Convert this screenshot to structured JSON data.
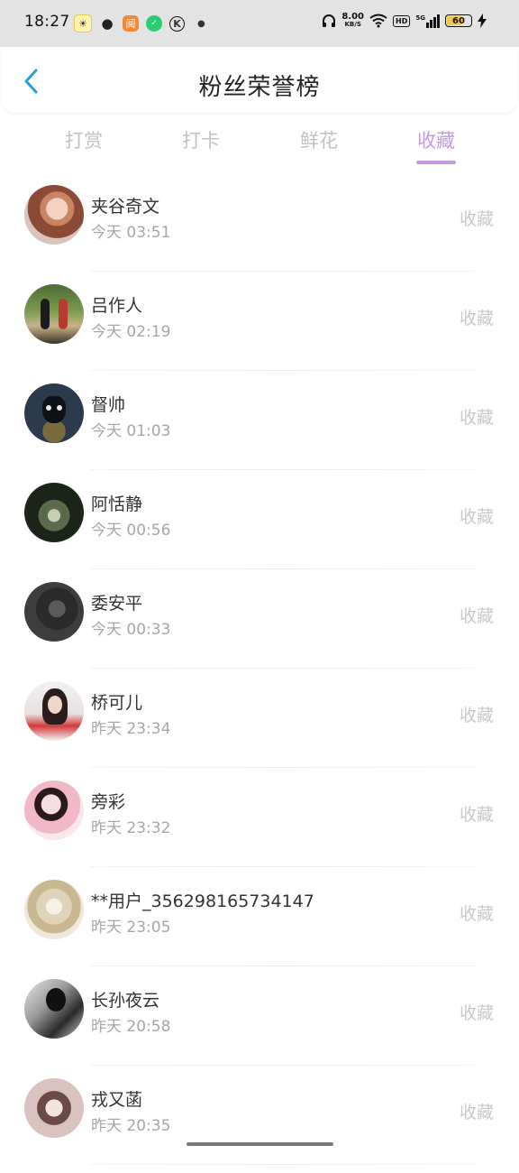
{
  "status_bar": {
    "time": "18:27",
    "net_speed": "8.00",
    "net_unit": "KB/S",
    "hd": "HD",
    "signal": "5G",
    "battery": "60"
  },
  "header": {
    "title": "粉丝荣誉榜"
  },
  "tabs": [
    {
      "label": "打赏",
      "active": false
    },
    {
      "label": "打卡",
      "active": false
    },
    {
      "label": "鲜花",
      "active": false
    },
    {
      "label": "收藏",
      "active": true
    }
  ],
  "colors": {
    "accent": "#c59be0",
    "muted": "#c9c9c9",
    "subtext": "#a6a6a6"
  },
  "fans": [
    {
      "name": "夹谷奇文",
      "time": "今天 03:51",
      "action": "收藏"
    },
    {
      "name": "吕作人",
      "time": "今天 02:19",
      "action": "收藏"
    },
    {
      "name": "督帅",
      "time": "今天 01:03",
      "action": "收藏"
    },
    {
      "name": "阿恬静",
      "time": "今天 00:56",
      "action": "收藏"
    },
    {
      "name": "委安平",
      "time": "今天 00:33",
      "action": "收藏"
    },
    {
      "name": "桥可儿",
      "time": "昨天 23:34",
      "action": "收藏"
    },
    {
      "name": "旁彩",
      "time": "昨天 23:32",
      "action": "收藏"
    },
    {
      "name": "**用户_356298165734147",
      "time": "昨天 23:05",
      "action": "收藏"
    },
    {
      "name": "长孙夜云",
      "time": "昨天 20:58",
      "action": "收藏"
    },
    {
      "name": "戎又菡",
      "time": "昨天 20:35",
      "action": "收藏"
    }
  ]
}
